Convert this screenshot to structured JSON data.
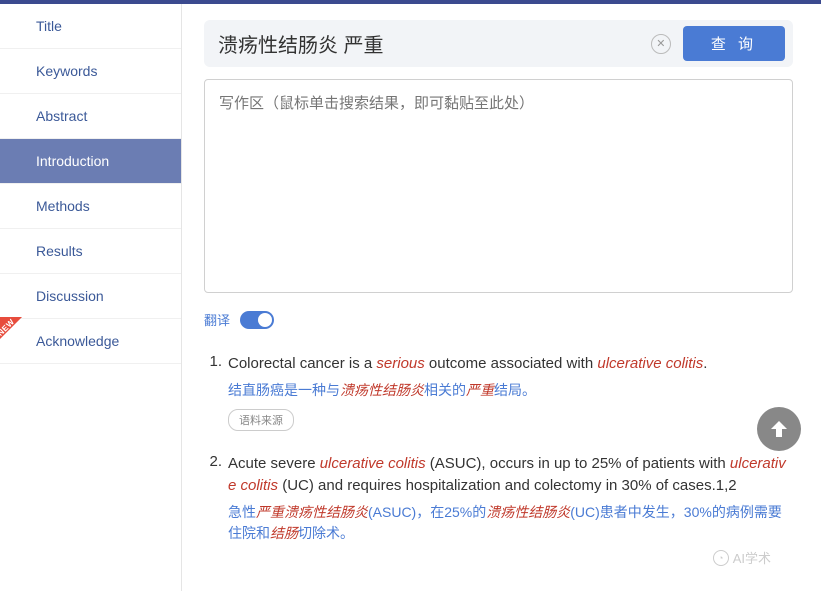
{
  "sidebar": {
    "items": [
      {
        "label": "Title"
      },
      {
        "label": "Keywords"
      },
      {
        "label": "Abstract"
      },
      {
        "label": "Introduction"
      },
      {
        "label": "Methods"
      },
      {
        "label": "Results"
      },
      {
        "label": "Discussion"
      },
      {
        "label": "Acknowledge"
      }
    ],
    "new_badge": "NEW"
  },
  "search": {
    "value": "溃疡性结肠炎 严重",
    "query_btn": "查 询"
  },
  "writing": {
    "placeholder": "写作区（鼠标单击搜索结果，即可黏贴至此处）"
  },
  "translate": {
    "label": "翻译"
  },
  "results": [
    {
      "num": "1.",
      "en_parts": [
        "Colorectal cancer is a ",
        "serious",
        " outcome associated with ",
        "ulcerative colitis",
        "."
      ],
      "zh_parts": [
        "结直肠癌是一种与",
        "溃疡性结肠炎",
        "相关的",
        "严重",
        "结局。"
      ],
      "source": "语料来源"
    },
    {
      "num": "2.",
      "en_parts": [
        "Acute severe ",
        "ulcerative colitis",
        " (ASUC), occurs in up to 25% of patients with ",
        "ulcerative colitis",
        " (UC) and requires hospitalization and colectomy in 30% of cases.1,2"
      ],
      "zh_parts": [
        "急性",
        "严重溃疡性结肠炎",
        "(ASUC)，在25%的",
        "溃疡性结肠炎",
        "(UC)患者中发生，30%的病例需要住院和",
        "结肠",
        "切除术。"
      ]
    }
  ],
  "watermark": "AI学术"
}
